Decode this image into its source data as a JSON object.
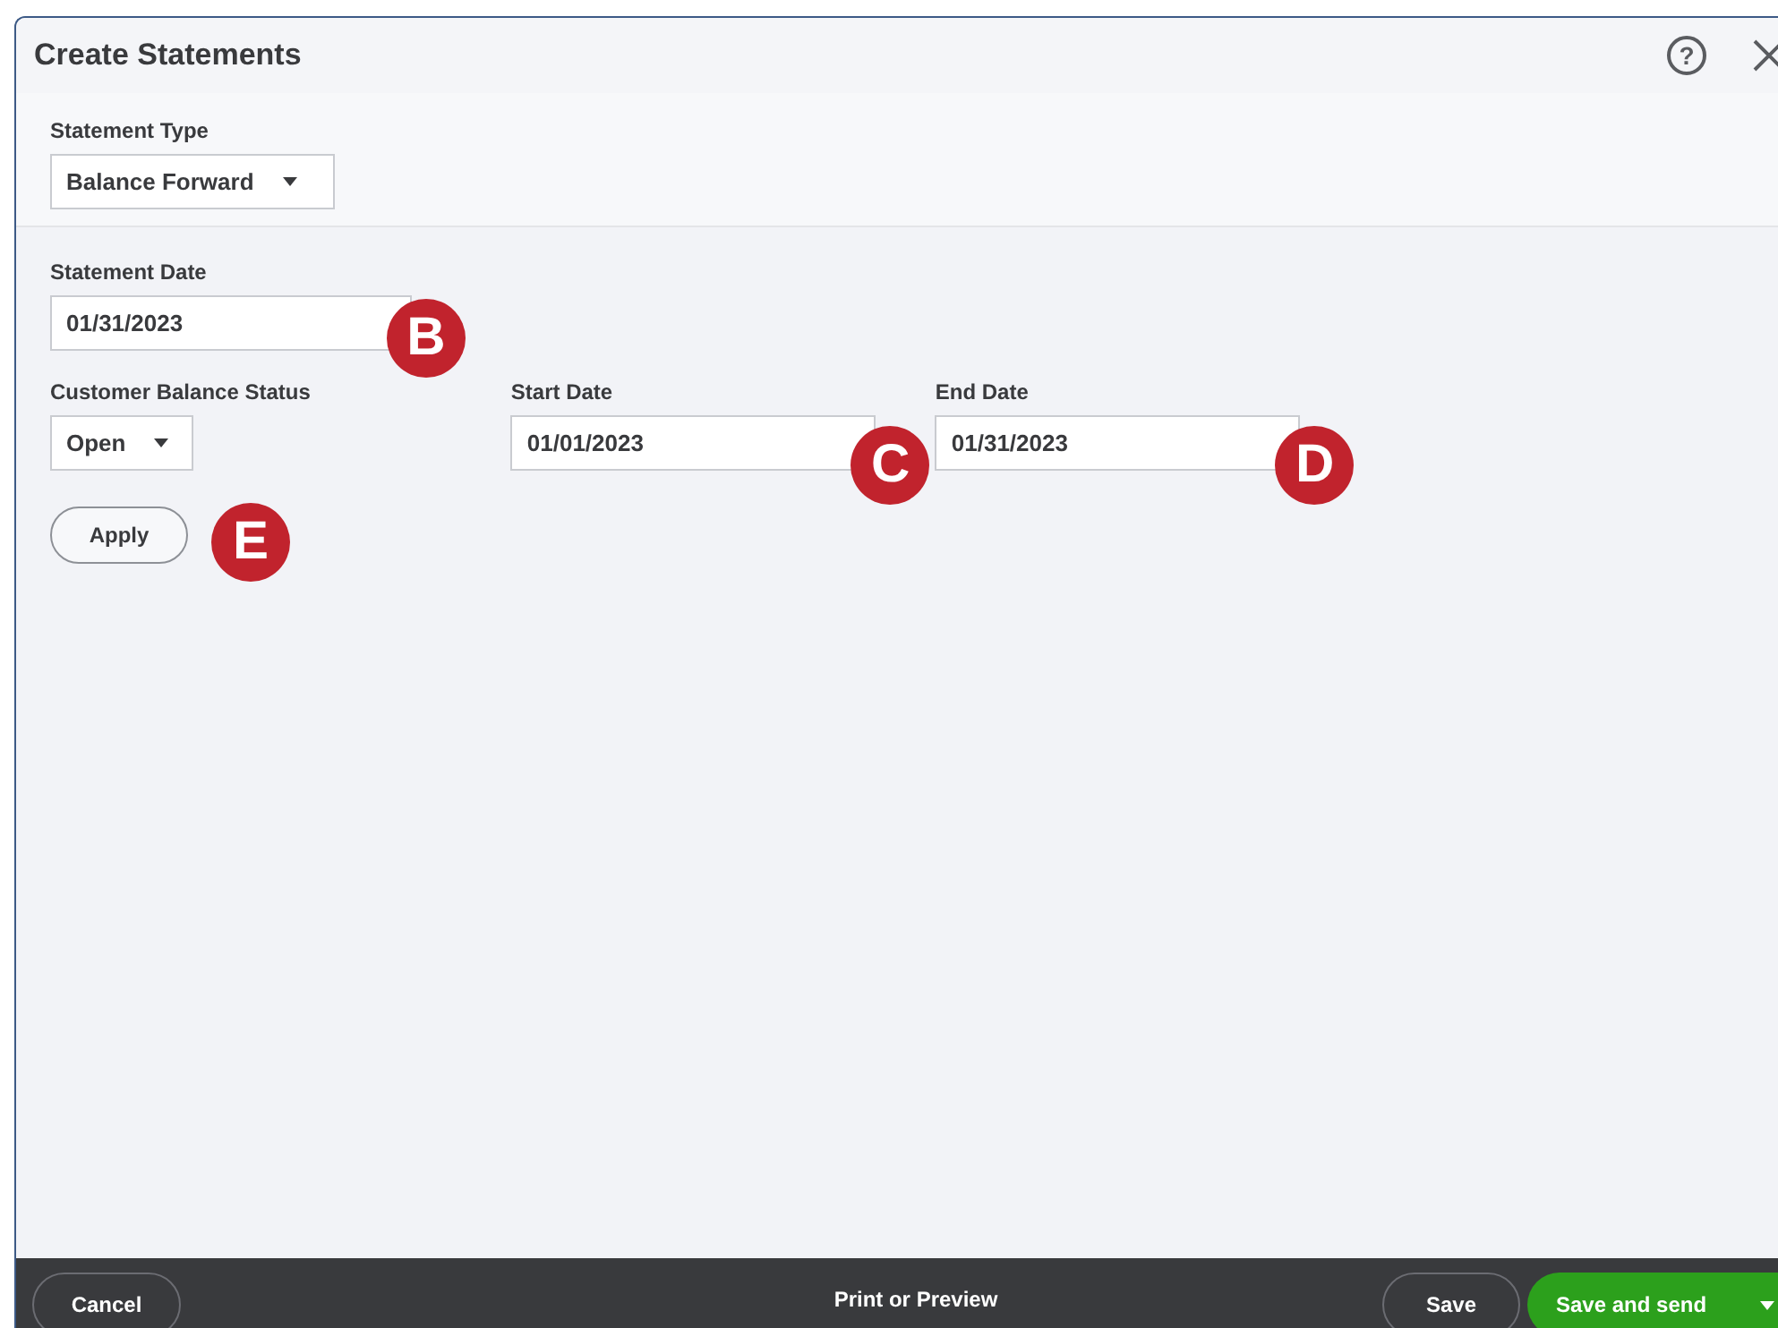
{
  "dialog": {
    "title": "Create Statements",
    "help": "?"
  },
  "statement_type": {
    "label": "Statement Type",
    "value": "Balance Forward"
  },
  "rows": [
    {
      "fields": [
        {
          "kind": "input",
          "label": "Statement Date",
          "value": "01/31/2023",
          "callout": "B"
        }
      ]
    },
    {
      "fields": [
        {
          "kind": "select",
          "label": "Customer Balance Status",
          "value": "Open"
        },
        {
          "kind": "input",
          "label": "Start Date",
          "value": "01/01/2023",
          "callout": "C"
        },
        {
          "kind": "input",
          "label": "End Date",
          "value": "01/31/2023",
          "callout": "D"
        }
      ]
    }
  ],
  "apply": {
    "label": "Apply",
    "callout": "E"
  },
  "footer": {
    "cancel": "Cancel",
    "print": "Print or Preview",
    "save": "Save",
    "save_and_send": "Save and send"
  }
}
